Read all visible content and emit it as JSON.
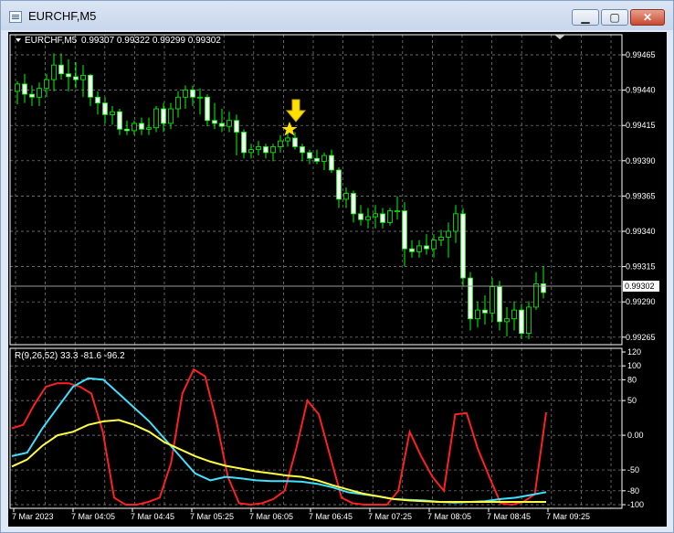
{
  "window": {
    "title": "EURCHF,M5",
    "buttons": {
      "minimize": "▁",
      "maximize": "▢",
      "close": "✕"
    }
  },
  "colors": {
    "background": "#000000",
    "grid": "#8a8a8a",
    "candle_up": "#00ff00",
    "candle_down": "#ffffff",
    "indicator_red": "#ff2020",
    "indicator_cyan": "#40e0ff",
    "indicator_yellow": "#ffff40",
    "arrow": "#ffe000"
  },
  "chart": {
    "symbol_header": "EURCHF,M5",
    "ohlc_text": "0.99307 0.99322 0.99299 0.99302",
    "current_price": "0.99302",
    "price_labels": [
      "0.99465",
      "0.99440",
      "0.99415",
      "0.99390",
      "0.99365",
      "0.99340",
      "0.99315",
      "0.99290",
      "0.99265"
    ],
    "indicator_header": "R(9,26,52) 33.3 -81.6 -96.2",
    "indicator_labels": [
      "120",
      "100",
      "80",
      "50",
      "0.00",
      "-50",
      "-80",
      "-100"
    ],
    "time_labels": [
      "7 Mar 2023",
      "7 Mar 04:05",
      "7 Mar 04:45",
      "7 Mar 05:25",
      "7 Mar 06:05",
      "7 Mar 06:45",
      "7 Mar 07:25",
      "7 Mar 08:05",
      "7 Mar 08:45",
      "7 Mar 09:25"
    ],
    "marker_icons": [
      "down-arrow-icon",
      "star-icon"
    ]
  },
  "chart_data": [
    {
      "type": "candlestick",
      "title": "EURCHF,M5",
      "ylim": [
        0.99265,
        0.99465
      ],
      "candles": [
        [
          0.9944,
          0.99447,
          0.99431,
          0.99445
        ],
        [
          0.99445,
          0.99452,
          0.99432,
          0.99438
        ],
        [
          0.99438,
          0.99444,
          0.9943,
          0.99436
        ],
        [
          0.99436,
          0.99446,
          0.9943,
          0.99442
        ],
        [
          0.99442,
          0.99452,
          0.99436,
          0.99448
        ],
        [
          0.99448,
          0.99466,
          0.9944,
          0.99458
        ],
        [
          0.99458,
          0.99466,
          0.99448,
          0.99452
        ],
        [
          0.99452,
          0.99462,
          0.9944,
          0.9945
        ],
        [
          0.9945,
          0.9946,
          0.99442,
          0.99448
        ],
        [
          0.99448,
          0.99458,
          0.99436,
          0.99451
        ],
        [
          0.99451,
          0.99452,
          0.9943,
          0.99436
        ],
        [
          0.99436,
          0.9944,
          0.99424,
          0.99432
        ],
        [
          0.99432,
          0.99436,
          0.99418,
          0.99424
        ],
        [
          0.99424,
          0.9943,
          0.99417,
          0.99426
        ],
        [
          0.99426,
          0.99428,
          0.9941,
          0.99414
        ],
        [
          0.99414,
          0.9942,
          0.9941,
          0.99413
        ],
        [
          0.99413,
          0.9942,
          0.9941,
          0.99418
        ],
        [
          0.99418,
          0.99422,
          0.9941,
          0.99414
        ],
        [
          0.99414,
          0.99422,
          0.9941,
          0.99415
        ],
        [
          0.99415,
          0.9943,
          0.99412,
          0.99428
        ],
        [
          0.99428,
          0.99432,
          0.99412,
          0.99418
        ],
        [
          0.99418,
          0.99432,
          0.99414,
          0.99428
        ],
        [
          0.99428,
          0.9944,
          0.99422,
          0.99436
        ],
        [
          0.99436,
          0.99444,
          0.99428,
          0.99441
        ],
        [
          0.99441,
          0.99444,
          0.9943,
          0.99436
        ],
        [
          0.99436,
          0.99442,
          0.99424,
          0.99436
        ],
        [
          0.99436,
          0.99438,
          0.99416,
          0.9942
        ],
        [
          0.9942,
          0.99432,
          0.99414,
          0.99418
        ],
        [
          0.99418,
          0.99428,
          0.99412,
          0.99416
        ],
        [
          0.99416,
          0.99426,
          0.99412,
          0.9942
        ],
        [
          0.9942,
          0.99424,
          0.99396,
          0.99412
        ],
        [
          0.99412,
          0.99414,
          0.99394,
          0.99398
        ],
        [
          0.99398,
          0.99404,
          0.99394,
          0.994
        ],
        [
          0.994,
          0.99406,
          0.99396,
          0.99402
        ],
        [
          0.99402,
          0.99404,
          0.99394,
          0.99398
        ],
        [
          0.99398,
          0.99404,
          0.99392,
          0.99402
        ],
        [
          0.99402,
          0.9941,
          0.99398,
          0.99406
        ],
        [
          0.99406,
          0.99412,
          0.99402,
          0.99408
        ],
        [
          0.99408,
          0.99412,
          0.994,
          0.99402
        ],
        [
          0.99402,
          0.99404,
          0.99392,
          0.99398
        ],
        [
          0.99398,
          0.994,
          0.9939,
          0.99394
        ],
        [
          0.99394,
          0.994,
          0.9939,
          0.99392
        ],
        [
          0.99392,
          0.99398,
          0.99386,
          0.99396
        ],
        [
          0.99396,
          0.994,
          0.99384,
          0.99386
        ],
        [
          0.99386,
          0.99388,
          0.9936,
          0.99366
        ],
        [
          0.99366,
          0.99374,
          0.9936,
          0.9937
        ],
        [
          0.9937,
          0.99372,
          0.9935,
          0.99356
        ],
        [
          0.99356,
          0.99362,
          0.99348,
          0.99352
        ],
        [
          0.99352,
          0.9936,
          0.99346,
          0.99354
        ],
        [
          0.99354,
          0.99362,
          0.99346,
          0.99356
        ],
        [
          0.99356,
          0.9936,
          0.99346,
          0.9935
        ],
        [
          0.9935,
          0.9936,
          0.99348,
          0.99358
        ],
        [
          0.99358,
          0.99368,
          0.99352,
          0.99358
        ],
        [
          0.99358,
          0.99364,
          0.9932,
          0.99332
        ],
        [
          0.99332,
          0.99338,
          0.99326,
          0.9933
        ],
        [
          0.9933,
          0.99338,
          0.99326,
          0.99334
        ],
        [
          0.99334,
          0.99342,
          0.99328,
          0.99332
        ],
        [
          0.99332,
          0.99342,
          0.99326,
          0.99338
        ],
        [
          0.99338,
          0.99345,
          0.99334,
          0.9934
        ],
        [
          0.9934,
          0.9935,
          0.99326,
          0.99344
        ],
        [
          0.99344,
          0.99362,
          0.99336,
          0.99356
        ],
        [
          0.99356,
          0.9936,
          0.99306,
          0.99312
        ],
        [
          0.99312,
          0.99316,
          0.99276,
          0.99284
        ],
        [
          0.99284,
          0.99296,
          0.99278,
          0.9929
        ],
        [
          0.9929,
          0.993,
          0.9928,
          0.99288
        ],
        [
          0.99288,
          0.99312,
          0.99282,
          0.99306
        ],
        [
          0.99306,
          0.9931,
          0.99276,
          0.99282
        ],
        [
          0.99282,
          0.99292,
          0.99272,
          0.99284
        ],
        [
          0.99284,
          0.99296,
          0.99276,
          0.9929
        ],
        [
          0.9929,
          0.99294,
          0.9927,
          0.99274
        ],
        [
          0.99274,
          0.99296,
          0.9927,
          0.99292
        ],
        [
          0.99292,
          0.99316,
          0.9929,
          0.99308
        ],
        [
          0.99308,
          0.9932,
          0.99298,
          0.99302
        ]
      ]
    },
    {
      "type": "line",
      "title": "R(9,26,52)",
      "ylim": [
        -100,
        120
      ],
      "series": [
        {
          "name": "",
          "color": "#ff2020",
          "values": [
            10,
            15,
            45,
            70,
            75,
            75,
            70,
            60,
            5,
            -90,
            -100,
            -100,
            -96,
            -90,
            -40,
            60,
            95,
            85,
            20,
            -60,
            -98,
            -100,
            -98,
            -92,
            -80,
            -20,
            50,
            30,
            -30,
            -90,
            -98,
            -100,
            -100,
            -100,
            -80,
            5,
            -30,
            -60,
            -80,
            30,
            32,
            -20,
            -60,
            -98,
            -100,
            -96,
            -85,
            33
          ]
        },
        {
          "name": "",
          "color": "#40e0ff",
          "values": [
            -30,
            -25,
            10,
            40,
            70,
            82,
            80,
            60,
            40,
            20,
            -5,
            -30,
            -55,
            -65,
            -60,
            -62,
            -65,
            -66,
            -66,
            -67,
            -70,
            -75,
            -82,
            -85,
            -88,
            -92,
            -93,
            -94,
            -96,
            -97,
            -96,
            -95,
            -92,
            -90,
            -86,
            -82
          ]
        },
        {
          "name": "",
          "color": "#ffff40",
          "values": [
            -45,
            -35,
            -15,
            0,
            5,
            15,
            20,
            22,
            15,
            5,
            -10,
            -20,
            -30,
            -38,
            -44,
            -48,
            -52,
            -55,
            -58,
            -60,
            -65,
            -72,
            -78,
            -84,
            -88,
            -92,
            -94,
            -95,
            -96,
            -96,
            -96,
            -96,
            -96,
            -96,
            -96,
            -96
          ]
        }
      ]
    }
  ]
}
